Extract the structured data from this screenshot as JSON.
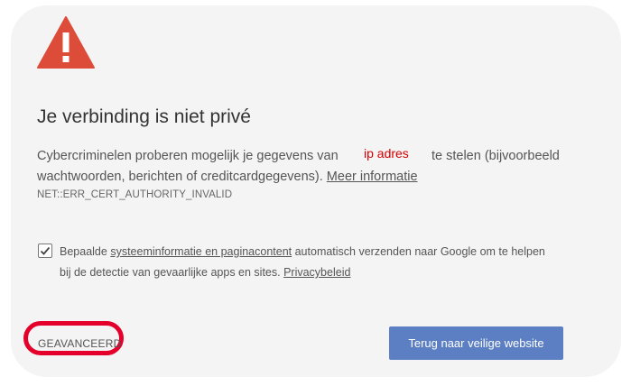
{
  "icon": "warning-triangle-icon",
  "colors": {
    "warning_red": "#dd4b39",
    "highlight_red": "#e4002b",
    "button_blue": "#5b7fc2",
    "ip_label_red": "#d40000"
  },
  "title": "Je verbinding is niet privé",
  "message": {
    "part1": "Cybercriminelen proberen mogelijk je gegevens van",
    "ip_placeholder": "ip adres",
    "part2": "te stelen (bijvoorbeeld",
    "part3": "wachtwoorden, berichten of creditcardgegevens).",
    "more_info_link": "Meer informatie"
  },
  "error_code": "NET::ERR_CERT_AUTHORITY_INVALID",
  "report": {
    "checked": true,
    "text1": "Bepaalde",
    "link1": "systeeminformatie en paginacontent",
    "text2": "automatisch verzenden naar Google om te helpen",
    "text3": "bij de detectie van gevaarlijke apps en sites.",
    "privacy_link": "Privacybeleid"
  },
  "advanced_button": "GEAVANCEERD",
  "back_button": "Terug naar veilige website"
}
